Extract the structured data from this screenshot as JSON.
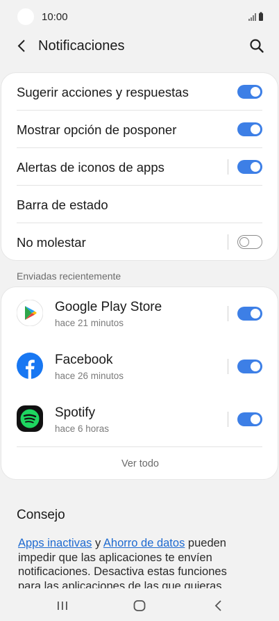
{
  "status_bar": {
    "time": "10:00"
  },
  "app_bar": {
    "title": "Notificaciones"
  },
  "settings": [
    {
      "label": "Sugerir acciones y respuestas",
      "toggle": "on"
    },
    {
      "label": "Mostrar opción de posponer",
      "toggle": "on"
    },
    {
      "label": "Alertas de iconos de apps",
      "toggle": "on"
    },
    {
      "label": "Barra de estado"
    },
    {
      "label": "No molestar",
      "toggle": "off"
    }
  ],
  "recent": {
    "section_label": "Enviadas recientemente",
    "apps": [
      {
        "name": "Google Play Store",
        "time": "hace 21 minutos",
        "icon": "google-play-icon",
        "toggle": "on"
      },
      {
        "name": "Facebook",
        "time": "hace 26 minutos",
        "icon": "facebook-icon",
        "toggle": "on"
      },
      {
        "name": "Spotify",
        "time": "hace 6 horas",
        "icon": "spotify-icon",
        "toggle": "on"
      }
    ],
    "see_all": "Ver todo"
  },
  "tip": {
    "title": "Consejo",
    "link1": "Apps inactivas",
    "and": " y ",
    "link2": "Ahorro de datos",
    "text_rest": " pueden impedir que las aplicaciones te envíen notificaciones. Desactiva estas funciones para las aplicaciones de las que quieras"
  },
  "colors": {
    "accent": "#3d7fe6",
    "link": "#1e6ad0",
    "background": "#f2f2f2"
  }
}
